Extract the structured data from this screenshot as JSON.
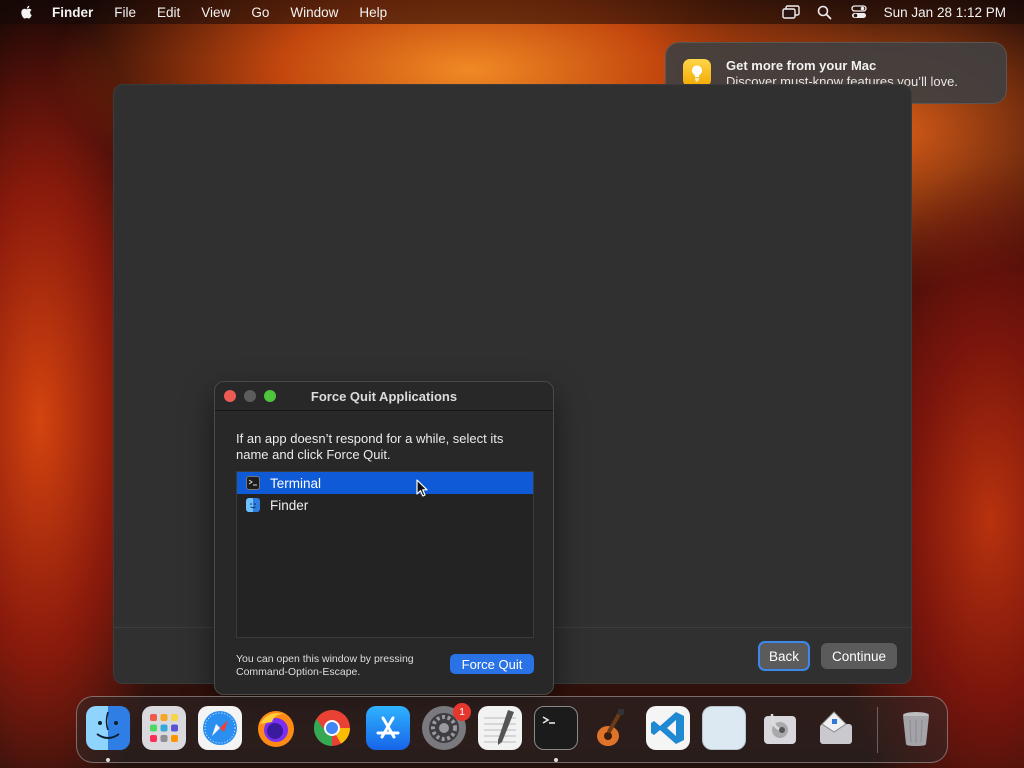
{
  "menubar": {
    "app_name": "Finder",
    "items": [
      "File",
      "Edit",
      "View",
      "Go",
      "Window",
      "Help"
    ],
    "icons": [
      "screen-mirroring-icon",
      "search-icon",
      "control-center-icon"
    ],
    "clock": "Sun Jan 28  1:12 PM"
  },
  "notification": {
    "title": "Get more from your Mac",
    "body": "Discover must-know features you’ll love.",
    "icon": "lightbulb-icon"
  },
  "background_window": {
    "back_label": "Back",
    "continue_label": "Continue"
  },
  "force_quit": {
    "title": "Force Quit Applications",
    "instructions": "If an app doesn’t respond for a while, select its name and click Force Quit.",
    "apps": [
      {
        "name": "Terminal",
        "selected": true,
        "icon": "terminal-icon"
      },
      {
        "name": "Finder",
        "selected": false,
        "icon": "finder-icon"
      }
    ],
    "hint": "You can open this window by pressing Command-Option-Escape.",
    "button_label": "Force Quit"
  },
  "dock": {
    "apps": [
      "Finder",
      "Launchpad",
      "Safari",
      "Firefox",
      "Chrome",
      "App Store",
      "System Settings",
      "TextEdit",
      "Terminal",
      "GarageBand",
      "Visual Studio Code",
      "Preview",
      "Disk Utility",
      "Boot Camp Assistant",
      "Trash"
    ],
    "running": [
      "Finder",
      "Terminal"
    ],
    "settings_badge": "1"
  },
  "colors": {
    "accent_blue": "#0f5ad6",
    "close_red": "#ec5c55",
    "zoom_green": "#4fc23e"
  }
}
